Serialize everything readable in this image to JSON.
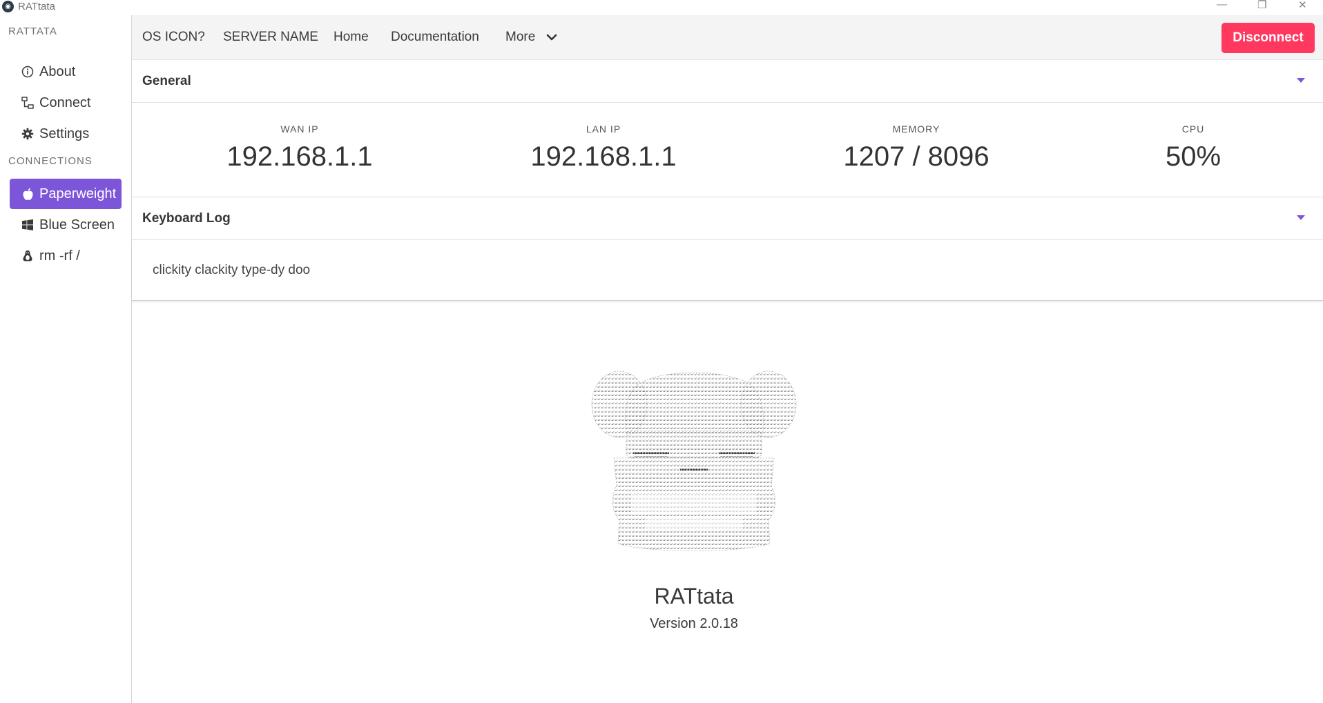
{
  "window": {
    "title": "RATtata",
    "controls": [
      "—",
      "❐",
      "✕"
    ]
  },
  "sidebar": {
    "section_app": "RATTATA",
    "app_items": [
      {
        "label": "About",
        "icon": "info-icon"
      },
      {
        "label": "Connect",
        "icon": "network-icon"
      },
      {
        "label": "Settings",
        "icon": "gear-icon"
      }
    ],
    "section_connections": "CONNECTIONS",
    "connections": [
      {
        "label": "Paperweight",
        "icon": "apple-icon",
        "active": true
      },
      {
        "label": "Blue Screen",
        "icon": "windows-icon",
        "active": false
      },
      {
        "label": "rm -rf /",
        "icon": "linux-icon",
        "active": false
      }
    ]
  },
  "topnav": {
    "os_icon": "OS ICON?",
    "server_name": "SERVER NAME",
    "home": "Home",
    "documentation": "Documentation",
    "more": "More",
    "disconnect": "Disconnect"
  },
  "general": {
    "title": "General",
    "stats": [
      {
        "label": "WAN IP",
        "value": "192.168.1.1"
      },
      {
        "label": "LAN IP",
        "value": "192.168.1.1"
      },
      {
        "label": "MEMORY",
        "value": "1207 / 8096"
      },
      {
        "label": "CPU",
        "value": "50%"
      }
    ]
  },
  "keyboard_log": {
    "title": "Keyboard Log",
    "text": "clickity clackity type-dy doo"
  },
  "about": {
    "app_name": "RATtata",
    "version": "Version 2.0.18"
  },
  "colors": {
    "accent": "#7d55d8",
    "danger": "#ff3860",
    "nav_bg": "#f4f4f4"
  }
}
